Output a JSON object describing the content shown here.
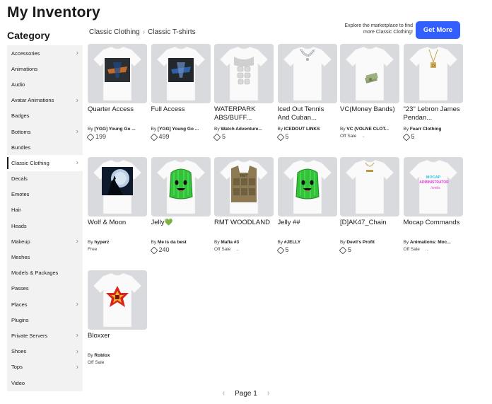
{
  "page": {
    "title": "My Inventory",
    "category_heading": "Category"
  },
  "sidebar": {
    "items": [
      {
        "label": "Accessories",
        "chevron": true
      },
      {
        "label": "Animations",
        "chevron": false
      },
      {
        "label": "Audio",
        "chevron": false
      },
      {
        "label": "Avatar Animations",
        "chevron": true
      },
      {
        "label": "Badges",
        "chevron": false
      },
      {
        "label": "Bottoms",
        "chevron": true
      },
      {
        "label": "Bundles",
        "chevron": false
      },
      {
        "label": "Classic Clothing",
        "chevron": true,
        "active": true
      },
      {
        "label": "Decals",
        "chevron": false
      },
      {
        "label": "Emotes",
        "chevron": false
      },
      {
        "label": "Hair",
        "chevron": false
      },
      {
        "label": "Heads",
        "chevron": false
      },
      {
        "label": "Makeup",
        "chevron": true
      },
      {
        "label": "Meshes",
        "chevron": false
      },
      {
        "label": "Models & Packages",
        "chevron": false
      },
      {
        "label": "Passes",
        "chevron": false
      },
      {
        "label": "Places",
        "chevron": true
      },
      {
        "label": "Plugins",
        "chevron": false
      },
      {
        "label": "Private Servers",
        "chevron": true
      },
      {
        "label": "Shoes",
        "chevron": true
      },
      {
        "label": "Tops",
        "chevron": true
      },
      {
        "label": "Video",
        "chevron": false
      }
    ]
  },
  "breadcrumb": {
    "parent": "Classic Clothing",
    "current": "Classic T-shirts"
  },
  "promo": {
    "text": "Explore the marketplace to find more Classic Clothing!",
    "button": "Get More"
  },
  "items": [
    {
      "name": "Quarter Access",
      "by": "By",
      "creator": "[YGG] Young Go ...",
      "price": "199",
      "offsale": "",
      "art": "dark-logo"
    },
    {
      "name": "Full Access",
      "by": "By",
      "creator": "[YGG] Young Go ...",
      "price": "499",
      "offsale": "",
      "art": "dark-logo-blue"
    },
    {
      "name": "WATERPARK ABS/BUFF...",
      "by": "By",
      "creator": "Watch Adventure...",
      "price": "5",
      "offsale": "",
      "art": "abs"
    },
    {
      "name": "Iced Out Tennis And Cuban...",
      "by": "By",
      "creator": "ICEDOUT LINKS",
      "price": "5",
      "offsale": "",
      "art": "chain"
    },
    {
      "name": "VC(Money Bands)",
      "by": "By",
      "creator": "VC (VOLNE CLOT...",
      "price": "",
      "offsale": "Off Sale",
      "art": "money"
    },
    {
      "name": "\"23\" Lebron James Pendan...",
      "by": "By",
      "creator": "Fearr Clothing",
      "price": "5",
      "offsale": "",
      "art": "pendant"
    },
    {
      "name": "Wolf & Moon",
      "by": "By",
      "creator": "hyperz",
      "price": "",
      "offsale": "Free",
      "art": "wolf"
    },
    {
      "name": "Jelly💚",
      "by": "By",
      "creator": "Me is da best",
      "price": "240",
      "offsale": "",
      "art": "jelly"
    },
    {
      "name": "RMT WOODLAND",
      "by": "By",
      "creator": "Mafia #3",
      "price": "",
      "offsale": "Off Sale",
      "art": "vest"
    },
    {
      "name": "Jelly ##",
      "by": "By",
      "creator": "#JELLY",
      "price": "5",
      "offsale": "",
      "art": "jelly"
    },
    {
      "name": "[D]AK47_Chain",
      "by": "By",
      "creator": "Devil's Profit",
      "price": "5",
      "offsale": "",
      "art": "small-chain"
    },
    {
      "name": "Mocap Commands",
      "by": "By",
      "creator": "Animations: Moc...",
      "price": "",
      "offsale": "Off Sale",
      "art": "mocap"
    },
    {
      "name": "Bloxxer",
      "by": "By",
      "creator": "Roblox",
      "price": "",
      "offsale": "Off Sale",
      "art": "bloxxer"
    }
  ],
  "item_overflow_marks": [
    "..",
    "..",
    ".."
  ],
  "mocap_text": [
    "MOCAP",
    "ADMINISTRATOR",
    "/cmds"
  ],
  "pager": {
    "label": "Page 1",
    "prev_icon": "chevron-left-icon",
    "next_icon": "chevron-right-icon"
  },
  "colors": {
    "accent": "#335fff",
    "thumb_bg": "#d9dade",
    "sidebar_bg": "#f2f2f3"
  }
}
